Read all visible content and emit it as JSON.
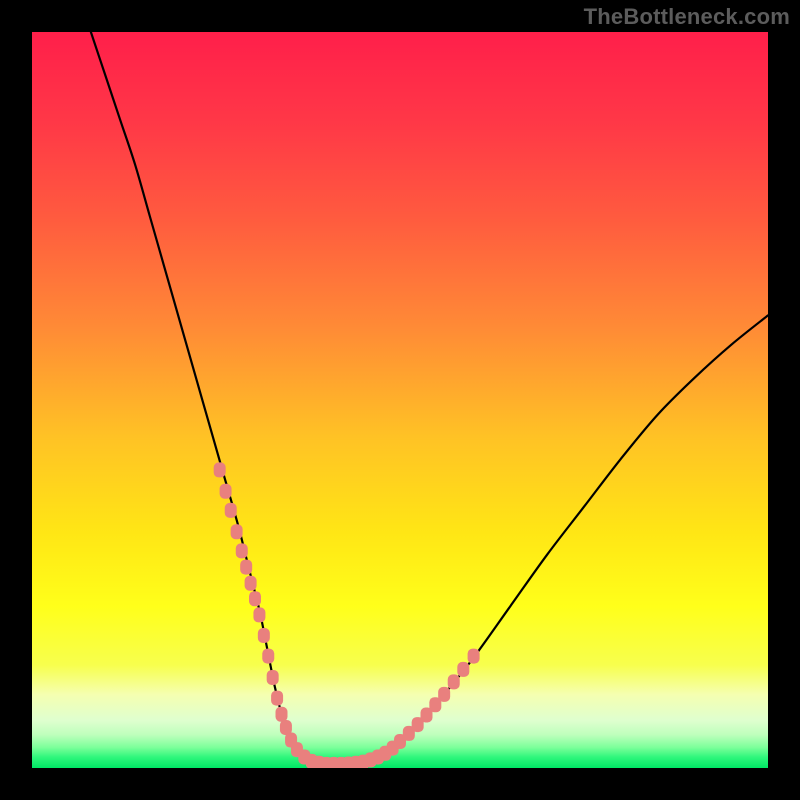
{
  "watermark": "TheBottleneck.com",
  "colors": {
    "black": "#000000",
    "curve": "#000000",
    "bead": "#e9807e",
    "gradient_stops": [
      {
        "offset": 0.0,
        "color": "#ff1f4a"
      },
      {
        "offset": 0.12,
        "color": "#ff3747"
      },
      {
        "offset": 0.25,
        "color": "#ff5a3f"
      },
      {
        "offset": 0.4,
        "color": "#ff8a36"
      },
      {
        "offset": 0.55,
        "color": "#ffc225"
      },
      {
        "offset": 0.68,
        "color": "#ffe615"
      },
      {
        "offset": 0.78,
        "color": "#ffff1a"
      },
      {
        "offset": 0.86,
        "color": "#f7ff4d"
      },
      {
        "offset": 0.9,
        "color": "#f5ffb0"
      },
      {
        "offset": 0.935,
        "color": "#dfffcf"
      },
      {
        "offset": 0.955,
        "color": "#beffbc"
      },
      {
        "offset": 0.972,
        "color": "#7cff9a"
      },
      {
        "offset": 0.985,
        "color": "#30f77c"
      },
      {
        "offset": 1.0,
        "color": "#00e765"
      }
    ]
  },
  "chart_data": {
    "type": "line",
    "title": "",
    "xlabel": "",
    "ylabel": "",
    "xlim": [
      0,
      100
    ],
    "ylim": [
      0,
      100
    ],
    "grid": false,
    "legend": false,
    "series": [
      {
        "name": "bottleneck-curve",
        "x": [
          8,
          10,
          12,
          14,
          16,
          18,
          20,
          22,
          24,
          26,
          28,
          29,
          30,
          31,
          32,
          33,
          34,
          35,
          36,
          37,
          38,
          40,
          42,
          44,
          46,
          48,
          50,
          53,
          56,
          60,
          65,
          70,
          75,
          80,
          85,
          90,
          95,
          100
        ],
        "y": [
          100,
          94,
          88,
          82,
          75,
          68,
          61,
          54,
          47,
          40,
          33,
          29,
          25,
          21,
          16,
          11,
          7,
          4,
          2.2,
          1.2,
          0.7,
          0.5,
          0.5,
          0.6,
          1.0,
          2.0,
          3.6,
          6.5,
          10,
          15,
          22,
          29,
          35.5,
          42,
          48,
          53,
          57.5,
          61.5
        ]
      }
    ],
    "bead_points": {
      "name": "data-markers",
      "x": [
        25.5,
        26.3,
        27.0,
        27.8,
        28.5,
        29.1,
        29.7,
        30.3,
        30.9,
        31.5,
        32.1,
        32.7,
        33.3,
        33.9,
        34.5,
        35.2,
        36.0,
        37.0,
        38.0,
        39.0,
        40.0,
        41.0,
        42.0,
        43.0,
        44.0,
        45.0,
        46.0,
        47.0,
        48.0,
        49.0,
        50.0,
        51.2,
        52.4,
        53.6,
        54.8,
        56.0,
        57.3,
        58.6,
        60.0
      ],
      "y": [
        40.5,
        37.6,
        35.0,
        32.1,
        29.5,
        27.3,
        25.1,
        23.0,
        20.8,
        18.0,
        15.2,
        12.3,
        9.5,
        7.3,
        5.5,
        3.8,
        2.5,
        1.5,
        0.9,
        0.65,
        0.5,
        0.5,
        0.5,
        0.55,
        0.65,
        0.8,
        1.1,
        1.5,
        2.0,
        2.7,
        3.6,
        4.7,
        5.9,
        7.2,
        8.6,
        10.0,
        11.7,
        13.4,
        15.2
      ]
    }
  }
}
